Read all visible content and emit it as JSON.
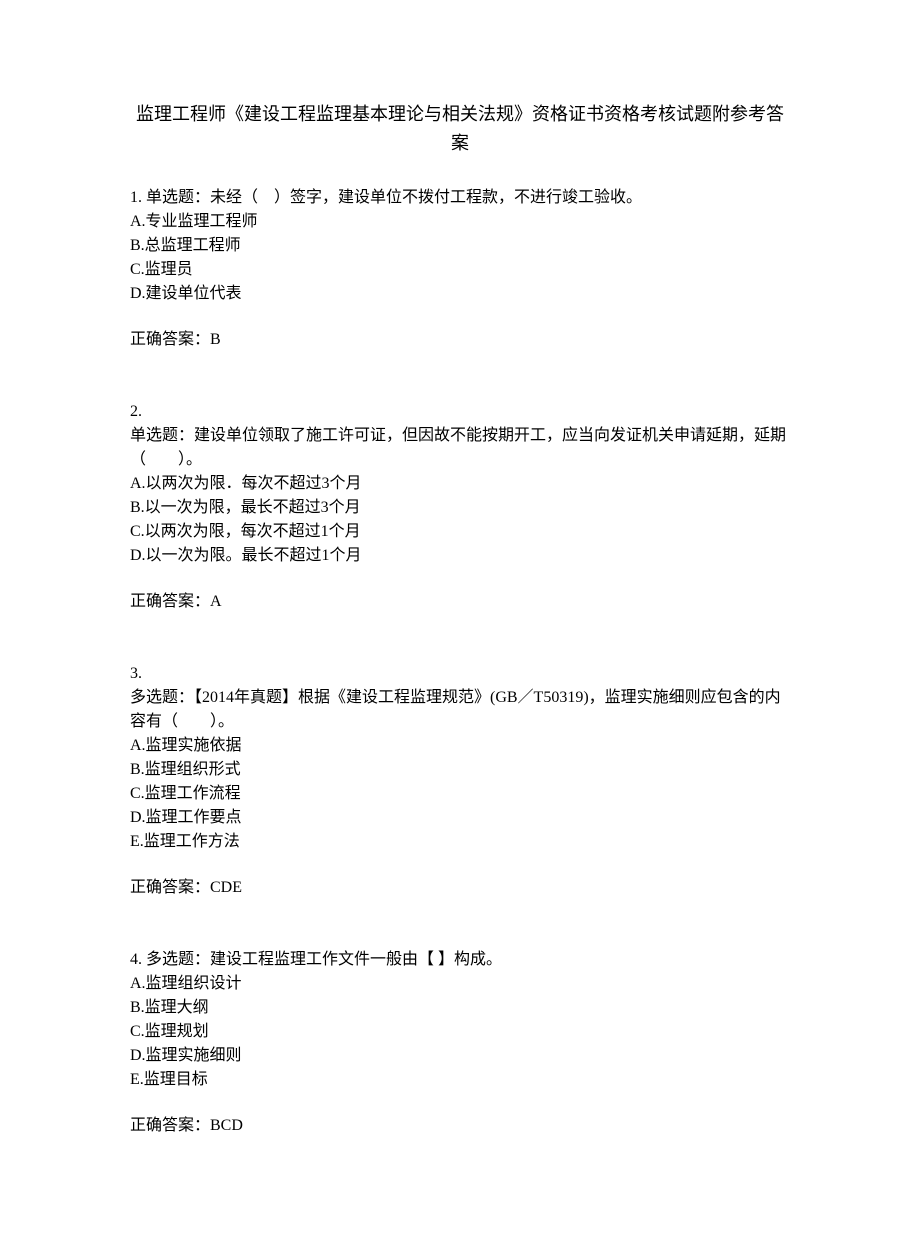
{
  "title": "监理工程师《建设工程监理基本理论与相关法规》资格证书资格考核试题附参考答案",
  "questions": [
    {
      "number": "1.",
      "prompt": "单选题：未经（　）签字，建设单位不拨付工程款，不进行竣工验收。",
      "prompt_inline": true,
      "options": [
        "A.专业监理工程师",
        "B.总监理工程师",
        "C.监理员",
        "D.建设单位代表"
      ],
      "answer": "正确答案：B"
    },
    {
      "number": "2.",
      "prompt": "单选题：建设单位领取了施工许可证，但因故不能按期开工，应当向发证机关申请延期，延期（　　）。",
      "prompt_inline": false,
      "options": [
        "A.以两次为限．每次不超过3个月",
        "B.以一次为限，最长不超过3个月",
        "C.以两次为限，每次不超过1个月",
        "D.以一次为限。最长不超过1个月"
      ],
      "answer": "正确答案：A"
    },
    {
      "number": "3.",
      "prompt": "多选题：【2014年真题】根据《建设工程监理规范》(GB／T50319)，监理实施细则应包含的内容有（　　）。",
      "prompt_inline": false,
      "options": [
        "A.监理实施依据",
        "B.监理组织形式",
        "C.监理工作流程",
        "D.监理工作要点",
        "E.监理工作方法"
      ],
      "answer": "正确答案：CDE"
    },
    {
      "number": "4.",
      "prompt": "多选题：建设工程监理工作文件一般由【 】构成。",
      "prompt_inline": true,
      "options": [
        "A.监理组织设计",
        "B.监理大纲",
        "C.监理规划",
        "D.监理实施细则",
        "E.监理目标"
      ],
      "answer": "正确答案：BCD"
    }
  ]
}
